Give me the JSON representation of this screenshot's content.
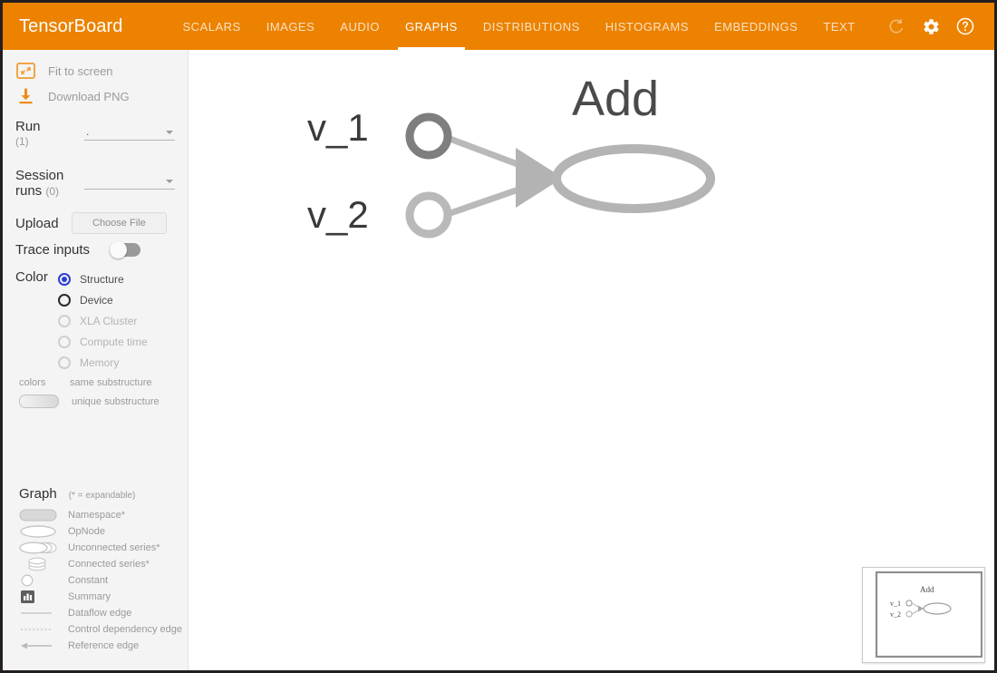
{
  "app": {
    "brand": "TensorBoard",
    "accent_color": "#ec8200",
    "sidebar_bg": "#f4f4f4"
  },
  "header": {
    "tabs": [
      {
        "label": "SCALARS",
        "active": false
      },
      {
        "label": "IMAGES",
        "active": false
      },
      {
        "label": "AUDIO",
        "active": false
      },
      {
        "label": "GRAPHS",
        "active": true
      },
      {
        "label": "DISTRIBUTIONS",
        "active": false
      },
      {
        "label": "HISTOGRAMS",
        "active": false
      },
      {
        "label": "EMBEDDINGS",
        "active": false
      },
      {
        "label": "TEXT",
        "active": false
      }
    ],
    "actions": [
      {
        "name": "refresh-icon",
        "title": "Refresh"
      },
      {
        "name": "settings-gear-icon",
        "title": "Settings"
      },
      {
        "name": "help-icon",
        "title": "Help"
      }
    ]
  },
  "sidebar": {
    "fit_to_screen": "Fit to screen",
    "download_png": "Download PNG",
    "run": {
      "label": "Run",
      "count": "(1)",
      "value": "."
    },
    "session_runs": {
      "label_line1": "Session",
      "label_line2": "runs",
      "count": "(0)",
      "value": ""
    },
    "upload": {
      "label": "Upload",
      "button": "Choose File"
    },
    "trace_inputs": {
      "label": "Trace inputs",
      "state": "off"
    },
    "color": {
      "label": "Color",
      "options": [
        {
          "label": "Structure",
          "selected": true,
          "enabled": true
        },
        {
          "label": "Device",
          "selected": false,
          "enabled": true
        },
        {
          "label": "XLA Cluster",
          "selected": false,
          "enabled": false
        },
        {
          "label": "Compute time",
          "selected": false,
          "enabled": false
        },
        {
          "label": "Memory",
          "selected": false,
          "enabled": false
        }
      ],
      "colors_key": "colors",
      "colors_value": "same substructure",
      "gradient_value": "unique substructure"
    },
    "legend": {
      "title": "Graph",
      "subtitle": "(* = expandable)",
      "items": [
        {
          "icon": "namespace-icon",
          "label": "Namespace*"
        },
        {
          "icon": "opnode-icon",
          "label": "OpNode"
        },
        {
          "icon": "unconnected-series-icon",
          "label": "Unconnected series*"
        },
        {
          "icon": "connected-series-icon",
          "label": "Connected series*"
        },
        {
          "icon": "constant-icon",
          "label": "Constant"
        },
        {
          "icon": "summary-icon",
          "label": "Summary"
        },
        {
          "icon": "dataflow-edge-icon",
          "label": "Dataflow edge"
        },
        {
          "icon": "control-dependency-edge-icon",
          "label": "Control dependency edge"
        },
        {
          "icon": "reference-edge-icon",
          "label": "Reference edge"
        }
      ]
    }
  },
  "graph": {
    "nodes": [
      {
        "id": "v_1",
        "label": "v_1",
        "type": "constant",
        "color": "#7e7e7e"
      },
      {
        "id": "v_2",
        "label": "v_2",
        "type": "constant",
        "color": "#b9b9b9"
      },
      {
        "id": "Add",
        "label": "Add",
        "type": "opnode",
        "color": "#b4b4b4"
      }
    ],
    "edges": [
      {
        "from": "v_1",
        "to": "Add"
      },
      {
        "from": "v_2",
        "to": "Add"
      }
    ]
  },
  "minimap": {
    "nodes": [
      {
        "label": "v_1"
      },
      {
        "label": "v_2"
      },
      {
        "label": "Add"
      }
    ]
  }
}
